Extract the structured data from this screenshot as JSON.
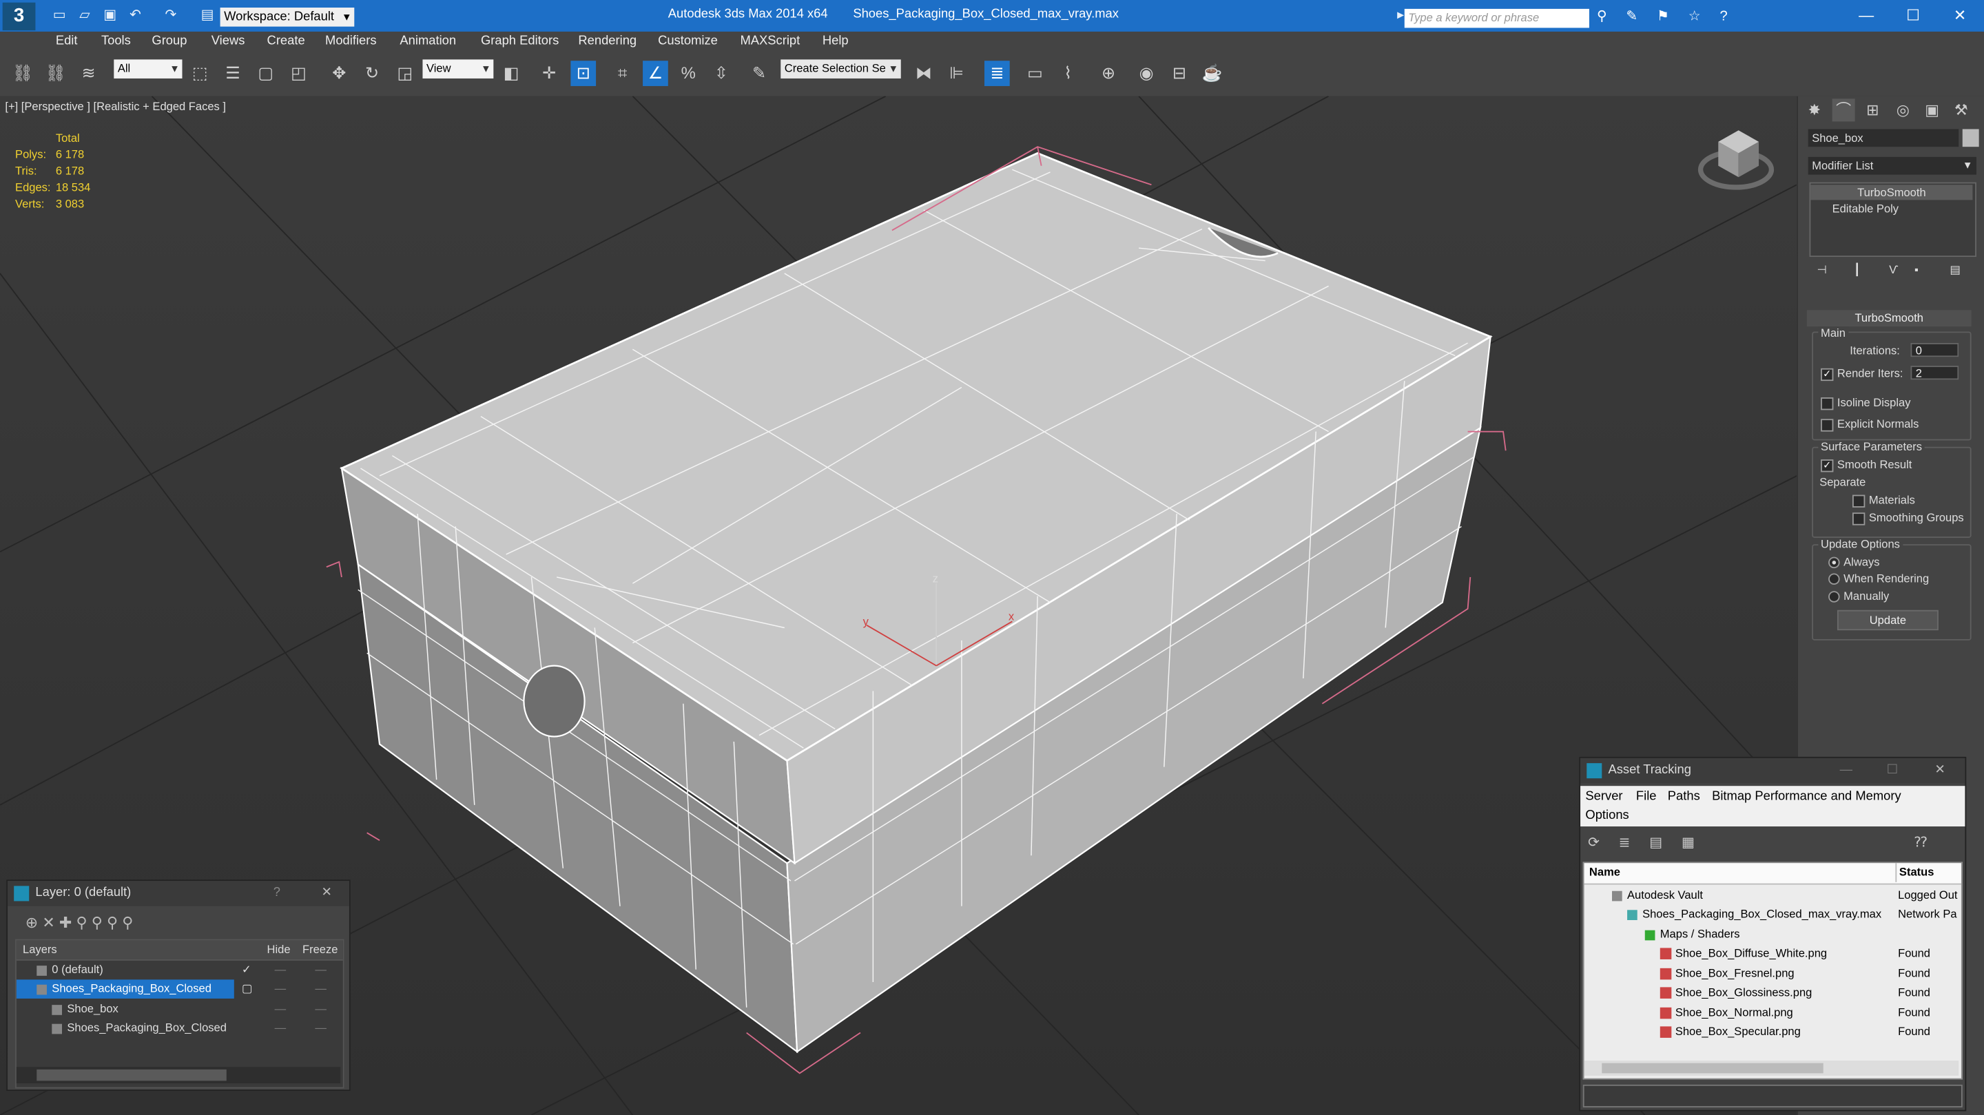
{
  "app": {
    "logo": "3",
    "title": "Autodesk 3ds Max  2014 x64",
    "file": "Shoes_Packaging_Box_Closed_max_vray.max",
    "workspace": "Workspace: Default",
    "search_placeholder": "Type a keyword or phrase"
  },
  "menu": [
    "Edit",
    "Tools",
    "Group",
    "Views",
    "Create",
    "Modifiers",
    "Animation",
    "Graph Editors",
    "Rendering",
    "Customize",
    "MAXScript",
    "Help"
  ],
  "toolbar": {
    "filter": "All",
    "ref_coord": "View",
    "selection_set": "Create Selection Se"
  },
  "viewport": {
    "label": "[+] [Perspective ] [Realistic + Edged Faces ]",
    "stats_header": "Total",
    "stats": [
      {
        "k": "Polys:",
        "v": "6 178"
      },
      {
        "k": "Tris:",
        "v": "6 178"
      },
      {
        "k": "Edges:",
        "v": "18 534"
      },
      {
        "k": "Verts:",
        "v": "3 083"
      }
    ],
    "gizmo_x": "x",
    "gizmo_y": "y",
    "gizmo_z": "z"
  },
  "cmd": {
    "object_name": "Shoe_box",
    "modifier_list": "Modifier List",
    "stack": [
      "TurboSmooth",
      "Editable Poly"
    ],
    "rollout": "TurboSmooth",
    "main": "Main",
    "iterations_label": "Iterations:",
    "iterations": "0",
    "render_iters_label": "Render Iters:",
    "render_iters": "2",
    "isoline": "Isoline Display",
    "explicit_normals": "Explicit Normals",
    "surface_params": "Surface Parameters",
    "smooth_result": "Smooth Result",
    "separate": "Separate",
    "materials": "Materials",
    "smoothing_groups": "Smoothing Groups",
    "update_options": "Update Options",
    "always": "Always",
    "when_rendering": "When Rendering",
    "manually": "Manually",
    "update": "Update",
    "render_iters_checked": true,
    "smooth_result_checked": true
  },
  "layer_window": {
    "title": "Layer: 0 (default)",
    "help": "?",
    "col_layers": "Layers",
    "col_hide": "Hide",
    "col_freeze": "Freeze",
    "rows": [
      {
        "name": "0 (default)",
        "indent": 0,
        "selected": false
      },
      {
        "name": "Shoes_Packaging_Box_Closed",
        "indent": 0,
        "selected": true
      },
      {
        "name": "Shoe_box",
        "indent": 1,
        "selected": false
      },
      {
        "name": "Shoes_Packaging_Box_Closed",
        "indent": 1,
        "selected": false
      }
    ]
  },
  "asset_window": {
    "title": "Asset Tracking",
    "menus": [
      "Server",
      "File",
      "Paths",
      "Bitmap Performance and Memory"
    ],
    "options": "Options",
    "col_name": "Name",
    "col_status": "Status",
    "rows": [
      {
        "name": "Autodesk Vault",
        "status": "Logged Out",
        "level": 1
      },
      {
        "name": "Shoes_Packaging_Box_Closed_max_vray.max",
        "status": "Network Pa",
        "level": 2
      },
      {
        "name": "Maps / Shaders",
        "status": "",
        "level": 3
      },
      {
        "name": "Shoe_Box_Diffuse_White.png",
        "status": "Found",
        "level": 4
      },
      {
        "name": "Shoe_Box_Fresnel.png",
        "status": "Found",
        "level": 4
      },
      {
        "name": "Shoe_Box_Glossiness.png",
        "status": "Found",
        "level": 4
      },
      {
        "name": "Shoe_Box_Normal.png",
        "status": "Found",
        "level": 4
      },
      {
        "name": "Shoe_Box_Specular.png",
        "status": "Found",
        "level": 4
      }
    ]
  }
}
